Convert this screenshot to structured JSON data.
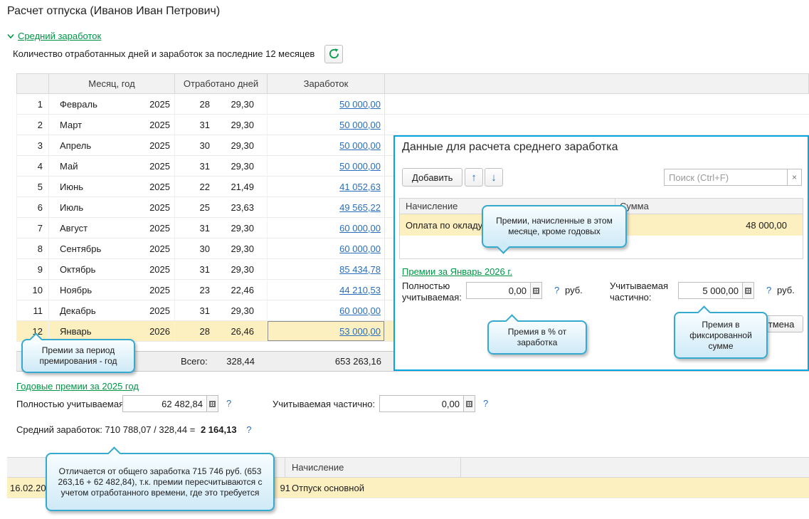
{
  "page": {
    "title": "Расчет отпуска (Иванов Иван Петрович)"
  },
  "section": {
    "toggle": "Средний заработок",
    "subtitle": "Количество отработанных дней и заработок за последние 12 месяцев"
  },
  "icons": {
    "move_up": "↑",
    "move_down": "↓",
    "clear": "×",
    "help": "?"
  },
  "earnings_table": {
    "col_month": "Месяц, год",
    "col_days": "Отработано дней",
    "col_earnings": "Заработок",
    "rows": [
      {
        "n": "1",
        "month": "Февраль",
        "year": "2025",
        "days": "28",
        "coeff": "29,30",
        "sum": "50 000,00"
      },
      {
        "n": "2",
        "month": "Март",
        "year": "2025",
        "days": "31",
        "coeff": "29,30",
        "sum": "50 000,00"
      },
      {
        "n": "3",
        "month": "Апрель",
        "year": "2025",
        "days": "30",
        "coeff": "29,30",
        "sum": "50 000,00"
      },
      {
        "n": "4",
        "month": "Май",
        "year": "2025",
        "days": "31",
        "coeff": "29,30",
        "sum": "50 000,00"
      },
      {
        "n": "5",
        "month": "Июнь",
        "year": "2025",
        "days": "22",
        "coeff": "21,49",
        "sum": "41 052,63"
      },
      {
        "n": "6",
        "month": "Июль",
        "year": "2025",
        "days": "25",
        "coeff": "23,63",
        "sum": "49 565,22"
      },
      {
        "n": "7",
        "month": "Август",
        "year": "2025",
        "days": "31",
        "coeff": "29,30",
        "sum": "60 000,00"
      },
      {
        "n": "8",
        "month": "Сентябрь",
        "year": "2025",
        "days": "30",
        "coeff": "29,30",
        "sum": "60 000,00"
      },
      {
        "n": "9",
        "month": "Октябрь",
        "year": "2025",
        "days": "31",
        "coeff": "29,30",
        "sum": "85 434,78"
      },
      {
        "n": "10",
        "month": "Ноябрь",
        "year": "2025",
        "days": "23",
        "coeff": "22,46",
        "sum": "44 210,53"
      },
      {
        "n": "11",
        "month": "Декабрь",
        "year": "2025",
        "days": "31",
        "coeff": "29,30",
        "sum": "60 000,00"
      },
      {
        "n": "12",
        "month": "Январь",
        "year": "2026",
        "days": "28",
        "coeff": "26,46",
        "sum": "53 000,00"
      }
    ],
    "total_label": "Всего:",
    "total_coeff": "328,44",
    "total_sum": "653 263,16"
  },
  "dialog": {
    "title": "Данные для расчета среднего заработка",
    "add_button": "Добавить",
    "search_placeholder": "Поиск (Ctrl+F)",
    "col_accrual": "Начисление",
    "col_sum": "Сумма",
    "row_accrual": "Оплата по окладу",
    "row_sum": "48 000,00",
    "premiums_link": "Премии за Январь 2026 г.",
    "fully_label": "Полностью учитываемая:",
    "fully_value": "0,00",
    "partial_label": "Учитываемая частично:",
    "partial_value": "5 000,00",
    "rub": "руб.",
    "cancel_button": "Отмена"
  },
  "annual": {
    "link": "Годовые премии за 2025 год",
    "fully_label": "Полностью учитываемая:",
    "fully_value": "62 482,84",
    "partial_label": "Учитываемая частично:",
    "partial_value": "0,00"
  },
  "average": {
    "prefix": "Средний заработок: 710 788,07 / 328,44 =",
    "value": "2 164,13"
  },
  "tooltips": {
    "monthly": "Премии, начисленные в этом месяце, кроме годовых",
    "percent": "Премия в % от заработка",
    "fixed": "Премия в фиксированной сумме",
    "period": "Премии за период премирования - год",
    "differs": "Отличается от общего заработка 715 746 руб. (653 263,16 + 62 482,84), т.к. премии пересчитываются с учетом отработанного времени, где это требуется"
  },
  "bottom_table": {
    "col_accrual": "Начисление",
    "row_date": "16.02.2026",
    "row_fragment": "91",
    "row_accrual": "Отпуск основной"
  }
}
